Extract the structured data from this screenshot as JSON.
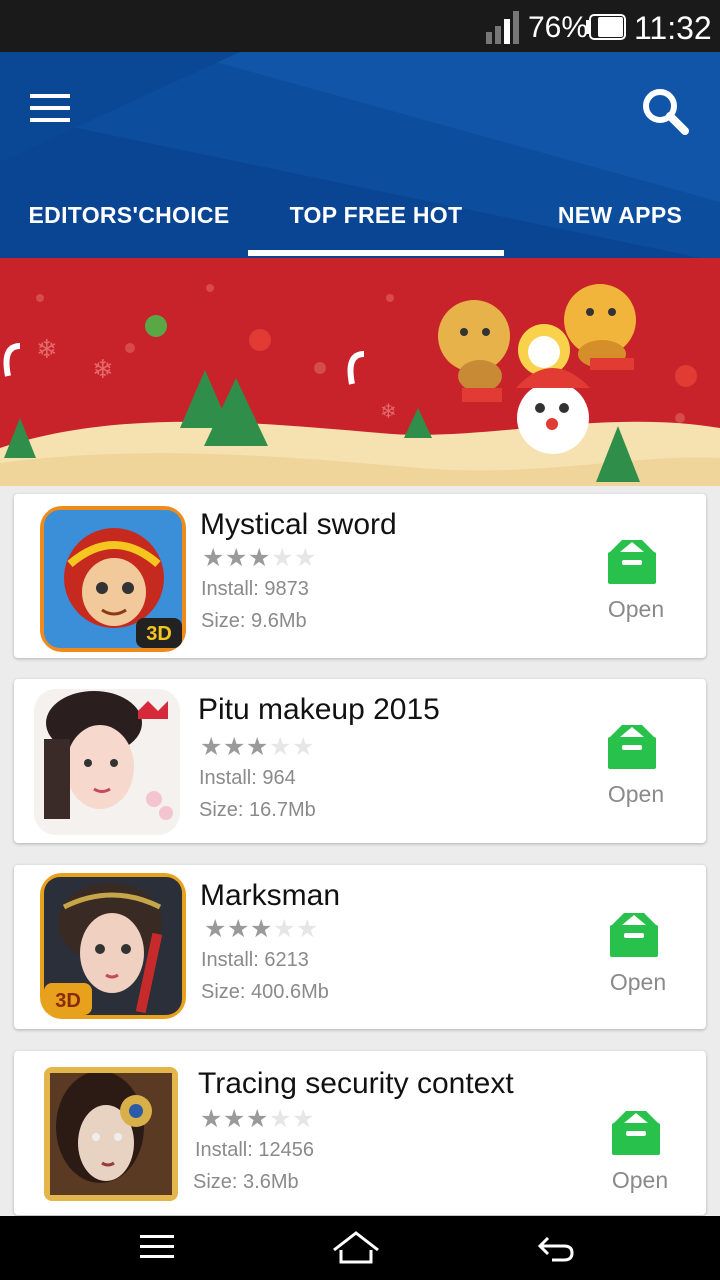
{
  "status_bar": {
    "battery": "76%",
    "time": "11:32"
  },
  "header": {
    "menu_icon": "hamburger-menu-icon",
    "search_icon": "search-icon",
    "tabs": [
      {
        "label": "EDITORS'CHOICE"
      },
      {
        "label": "TOP FREE HOT",
        "selected": true
      },
      {
        "label": "NEW APPS"
      }
    ]
  },
  "banner": {
    "theme": "christmas",
    "colors": {
      "bg": "#c8232b",
      "snow": "#f5e2b0"
    }
  },
  "apps": [
    {
      "name": "Mystical sword",
      "rating": 3,
      "install": "Install: 9873",
      "size": "Size: 9.6Mb",
      "action": "Open",
      "icon_badge": "3D"
    },
    {
      "name": "Pitu makeup 2015",
      "rating": 3,
      "install": "Install:  964",
      "size": "Size:  16.7Mb",
      "action": "Open"
    },
    {
      "name": "Marksman",
      "rating": 3,
      "install": "Install:  6213",
      "size": "Size:  400.6Mb",
      "action": "Open",
      "icon_badge": "3D"
    },
    {
      "name": "Tracing security context",
      "rating": 3,
      "install": "Install: 12456",
      "size": "Size:  3.6Mb",
      "action": "Open"
    }
  ],
  "nav_bar": {
    "icons": [
      "menu-icon",
      "home-icon",
      "back-icon"
    ]
  },
  "colors": {
    "header": "#0d4d9e",
    "accent_green": "#27c14c",
    "status_bar": "#1a1a1a"
  }
}
